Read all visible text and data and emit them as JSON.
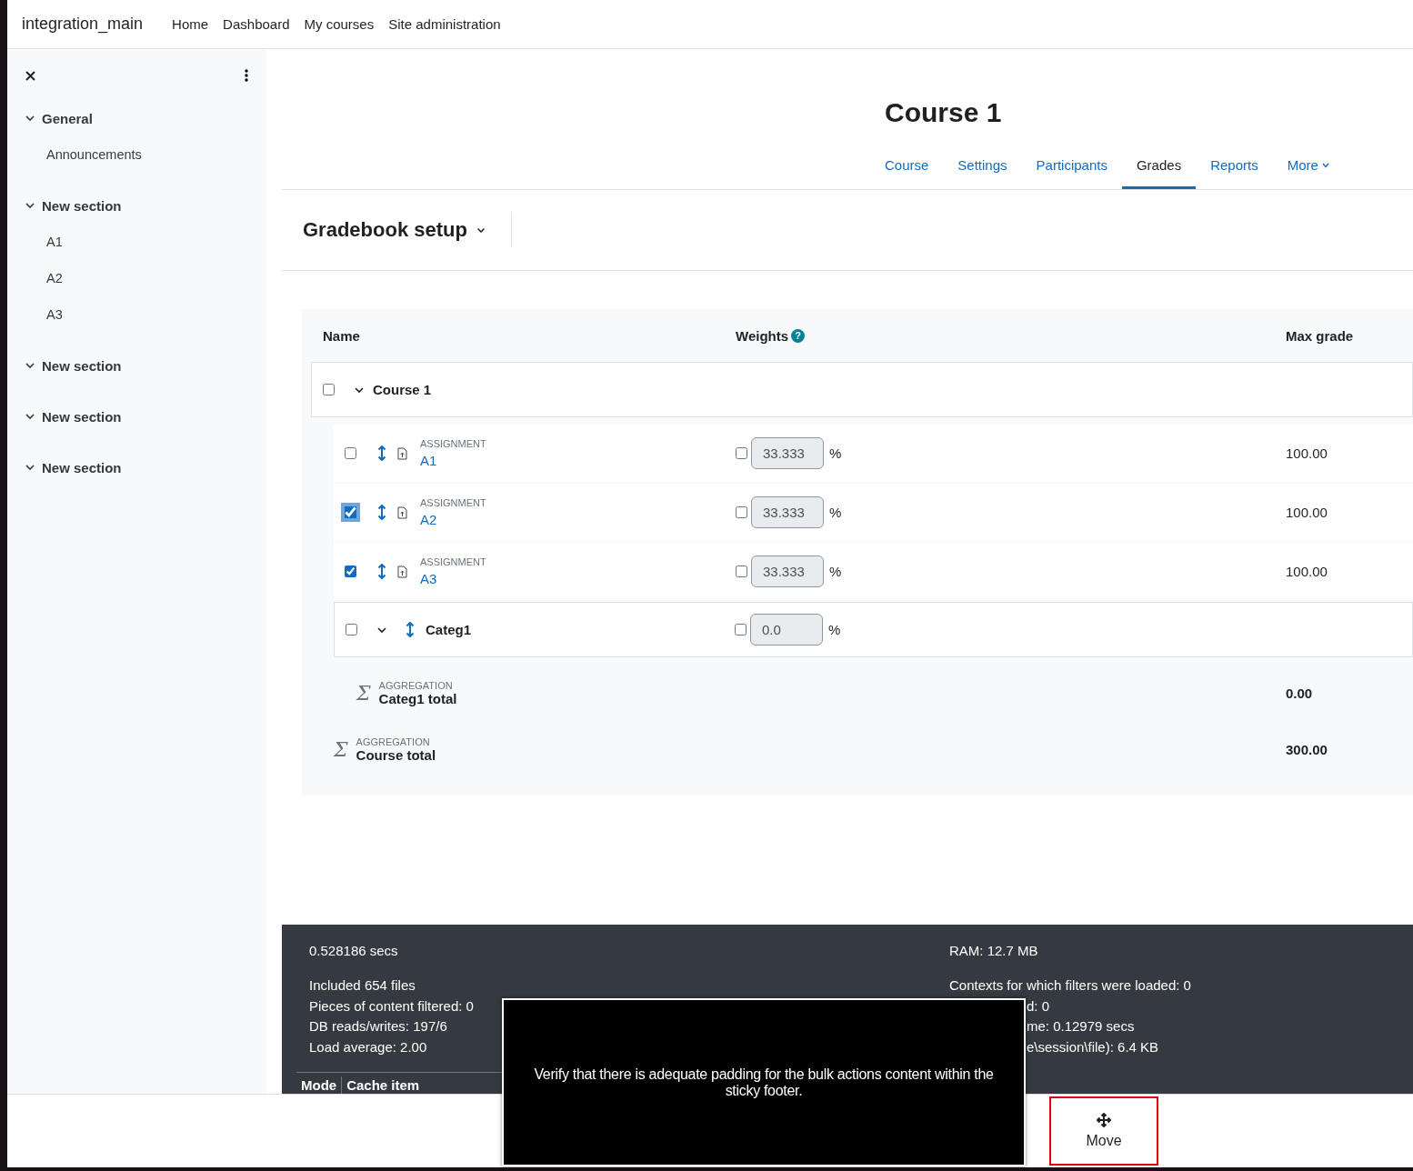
{
  "navbar": {
    "site_name": "integration_main",
    "links": [
      "Home",
      "Dashboard",
      "My courses",
      "Site administration"
    ]
  },
  "sidebar": {
    "sections": [
      {
        "title": "General",
        "expanded": true,
        "children": [
          {
            "label": "Announcements"
          }
        ]
      },
      {
        "title": "New section",
        "expanded": true,
        "children": [
          {
            "label": "A1"
          },
          {
            "label": "A2"
          },
          {
            "label": "A3"
          }
        ]
      },
      {
        "title": "New section",
        "expanded": true
      },
      {
        "title": "New section",
        "expanded": true
      },
      {
        "title": "New section",
        "expanded": true
      }
    ]
  },
  "course": {
    "title": "Course 1",
    "tabs": [
      {
        "label": "Course",
        "selected": false,
        "dropdown": false
      },
      {
        "label": "Settings",
        "selected": false,
        "dropdown": false
      },
      {
        "label": "Participants",
        "selected": false,
        "dropdown": false
      },
      {
        "label": "Grades",
        "selected": true,
        "dropdown": false
      },
      {
        "label": "Reports",
        "selected": false,
        "dropdown": false
      },
      {
        "label": "More",
        "selected": false,
        "dropdown": true
      }
    ]
  },
  "page_heading": {
    "title": "Gradebook setup"
  },
  "table": {
    "columns": [
      {
        "label": "Name"
      },
      {
        "label": "Weights",
        "help": "?"
      },
      {
        "label": "Max grade"
      }
    ],
    "rows": [
      {
        "kind": "category",
        "name": "Course 1",
        "checked": false,
        "expanded": true,
        "movable": false,
        "children": [
          {
            "kind": "item",
            "type_label": "ASSIGNMENT",
            "name": "A1",
            "checked": false,
            "focused": false,
            "movable": true,
            "weight": "33.333",
            "weight_override": false,
            "weight_unit": "%",
            "max_grade": "100.00"
          },
          {
            "kind": "item",
            "type_label": "ASSIGNMENT",
            "name": "A2",
            "checked": true,
            "focused": true,
            "movable": true,
            "weight": "33.333",
            "weight_override": false,
            "weight_unit": "%",
            "max_grade": "100.00"
          },
          {
            "kind": "item",
            "type_label": "ASSIGNMENT",
            "name": "A3",
            "checked": true,
            "focused": false,
            "movable": true,
            "weight": "33.333",
            "weight_override": false,
            "weight_unit": "%",
            "max_grade": "100.00"
          },
          {
            "kind": "category",
            "name": "Categ1",
            "checked": false,
            "expanded": true,
            "movable": true,
            "weight": "0.0",
            "weight_override": false,
            "weight_unit": "%",
            "children": [
              {
                "kind": "aggregation",
                "icon": "Σ",
                "type_label": "AGGREGATION",
                "name": "Categ1 total",
                "max_grade": "0.00"
              }
            ]
          },
          {
            "kind": "aggregation",
            "icon": "Σ",
            "type_label": "AGGREGATION",
            "name": "Course total",
            "max_grade": "300.00"
          }
        ]
      }
    ]
  },
  "footer": {
    "left": {
      "time": "0.528186 secs",
      "lines": [
        "Included 654 files",
        "Pieces of content filtered: 0",
        "DB reads/writes: 197/6",
        "Load average: 2.00"
      ]
    },
    "right": {
      "ram": "RAM: 12.7 MB",
      "lines": [
        {
          "text": "Contexts for which filters were loaded: 0",
          "covered": false
        },
        {
          "text": "d: 0",
          "covered": true
        },
        {
          "text": "me: 0.12979 secs",
          "covered": true
        },
        {
          "text": "e\\session\\file): 6.4 KB",
          "covered": true
        }
      ]
    },
    "cache_table": {
      "columns": [
        "Mode",
        "Cache item"
      ]
    }
  },
  "sticky_footer": {
    "popup": "Verify that there is adequate padding for the bulk actions content within the sticky footer.",
    "actions": [
      {
        "label": "Move",
        "highlighted": true
      }
    ]
  }
}
